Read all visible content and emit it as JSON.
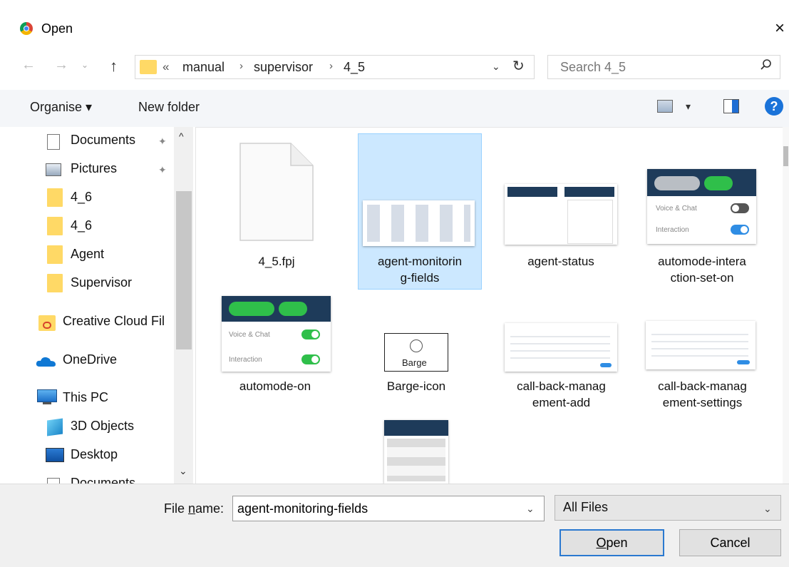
{
  "window": {
    "title": "Open",
    "close": "×"
  },
  "nav": {
    "up": "↑",
    "refresh": "↻",
    "dropdown": "⌄",
    "back": "←",
    "forward": "→",
    "recent": "⌄"
  },
  "address": {
    "prefix": "«",
    "crumbs": [
      "manual",
      "supervisor",
      "4_5"
    ],
    "sep": "›"
  },
  "search": {
    "placeholder": "Search 4_5"
  },
  "toolbar": {
    "organise": "Organise ▾",
    "new_folder": "New folder",
    "view_dd": "▾",
    "help": "?"
  },
  "sidebar": {
    "items": [
      {
        "label": "Documents",
        "icon": "documents-icon",
        "pinned": true
      },
      {
        "label": "Pictures",
        "icon": "pictures-icon",
        "pinned": true
      },
      {
        "label": "4_6",
        "icon": "folder-icon"
      },
      {
        "label": "4_6",
        "icon": "folder-icon"
      },
      {
        "label": "Agent",
        "icon": "folder-icon"
      },
      {
        "label": "Supervisor",
        "icon": "folder-icon"
      },
      {
        "label": "Creative Cloud Fil",
        "icon": "creative-cloud-icon"
      },
      {
        "label": "OneDrive",
        "icon": "onedrive-icon"
      },
      {
        "label": "This PC",
        "icon": "this-pc-icon"
      },
      {
        "label": "3D Objects",
        "icon": "3d-objects-icon"
      },
      {
        "label": "Desktop",
        "icon": "desktop-icon"
      },
      {
        "label": "Documents",
        "icon": "documents-icon"
      }
    ],
    "scroll_up": "^",
    "scroll_down": "⌄"
  },
  "files": [
    {
      "label": "4_5.fpj",
      "icon": "blank-file-icon"
    },
    {
      "label": "agent-monitorin\ng-fields",
      "icon": "image-thumbnail",
      "selected": true
    },
    {
      "label": "agent-status",
      "icon": "image-thumbnail"
    },
    {
      "label": "automode-intera\nction-set-on",
      "icon": "image-thumbnail"
    },
    {
      "label": "automode-on",
      "icon": "image-thumbnail"
    },
    {
      "label": "Barge-icon",
      "icon": "image-thumbnail"
    },
    {
      "label": "call-back-manag\nement-add",
      "icon": "image-thumbnail"
    },
    {
      "label": "call-back-manag\nement-settings",
      "icon": "image-thumbnail"
    },
    {
      "label": "",
      "icon": "image-thumbnail"
    }
  ],
  "thumb_text": {
    "voice_chat": "Voice & Chat",
    "interaction": "Interaction",
    "barge": "Barge"
  },
  "bottom": {
    "file_name_label_pre": "File ",
    "file_name_label_u": "n",
    "file_name_label_post": "ame:",
    "file_name_value": "agent-monitoring-fields",
    "file_name_dd": "⌄",
    "filter": "All Files",
    "filter_dd": "⌄",
    "open_u": "O",
    "open_rest": "pen",
    "cancel": "Cancel"
  },
  "colors": {
    "accent": "#2b79d0",
    "selected_bg": "#cce8ff",
    "toggle_green": "#2fbf4a",
    "toggle_blue": "#2f8de4",
    "header_navy": "#1e3b5a"
  }
}
